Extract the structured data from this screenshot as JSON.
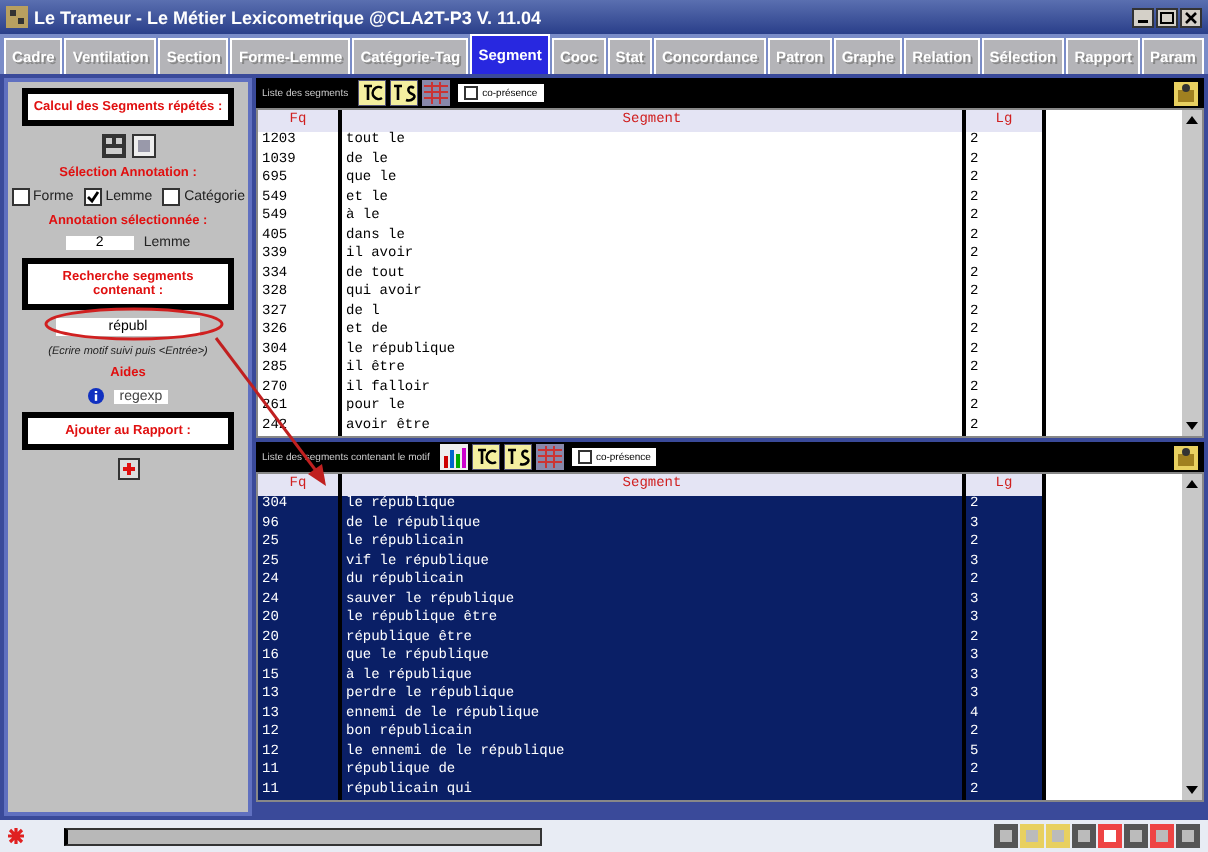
{
  "window": {
    "title": "Le Trameur - Le Métier Lexicometrique @CLA2T-P3 V. 11.04"
  },
  "tabs": [
    {
      "label": "Cadre",
      "selected": false
    },
    {
      "label": "Ventilation",
      "selected": false
    },
    {
      "label": "Section",
      "selected": false
    },
    {
      "label": "Forme-Lemme",
      "selected": false
    },
    {
      "label": "Catégorie-Tag",
      "selected": false
    },
    {
      "label": "Segment",
      "selected": true
    },
    {
      "label": "Cooc",
      "selected": false
    },
    {
      "label": "Stat",
      "selected": false
    },
    {
      "label": "Concordance",
      "selected": false
    },
    {
      "label": "Patron",
      "selected": false
    },
    {
      "label": "Graphe",
      "selected": false
    },
    {
      "label": "Relation",
      "selected": false
    },
    {
      "label": "Sélection",
      "selected": false
    },
    {
      "label": "Rapport",
      "selected": false
    },
    {
      "label": "Param",
      "selected": false
    }
  ],
  "left_panel": {
    "calc_heading": "Calcul des Segments répétés :",
    "annotation_heading": "Sélection Annotation :",
    "annotation_options": [
      {
        "label": "Forme",
        "checked": false
      },
      {
        "label": "Lemme",
        "checked": true
      },
      {
        "label": "Catégorie",
        "checked": false
      }
    ],
    "selected_heading": "Annotation sélectionnée :",
    "selected_value": "2",
    "selected_label": "Lemme",
    "search_heading": "Recherche segments contenant :",
    "search_value": "républ",
    "hint": "(Ecrire motif suivi puis <Entrée>)",
    "help_heading": "Aides",
    "regexp": "regexp",
    "report_heading": "Ajouter au Rapport :"
  },
  "grids": [
    {
      "toolbar_label": "Liste des segments",
      "copresence": {
        "label": "co-présence",
        "checked": false
      },
      "columns": [
        "Fq",
        "Segment",
        "Lg"
      ],
      "rows": [
        {
          "cells": [
            "1203",
            "tout le",
            "2"
          ],
          "selected": false
        },
        {
          "cells": [
            "1039",
            "de le",
            "2"
          ],
          "selected": false
        },
        {
          "cells": [
            "695",
            "que le",
            "2"
          ],
          "selected": false
        },
        {
          "cells": [
            "549",
            "et le",
            "2"
          ],
          "selected": false
        },
        {
          "cells": [
            "549",
            "à le",
            "2"
          ],
          "selected": false
        },
        {
          "cells": [
            "405",
            "dans le",
            "2"
          ],
          "selected": false
        },
        {
          "cells": [
            "339",
            "il avoir",
            "2"
          ],
          "selected": false
        },
        {
          "cells": [
            "334",
            "de tout",
            "2"
          ],
          "selected": false
        },
        {
          "cells": [
            "328",
            "qui avoir",
            "2"
          ],
          "selected": false
        },
        {
          "cells": [
            "327",
            "de l",
            "2"
          ],
          "selected": false
        },
        {
          "cells": [
            "326",
            "et de",
            "2"
          ],
          "selected": false
        },
        {
          "cells": [
            "304",
            "le république",
            "2"
          ],
          "selected": false
        },
        {
          "cells": [
            "285",
            "il être",
            "2"
          ],
          "selected": false
        },
        {
          "cells": [
            "270",
            "il falloir",
            "2"
          ],
          "selected": false
        },
        {
          "cells": [
            "261",
            "pour le",
            "2"
          ],
          "selected": false
        },
        {
          "cells": [
            "242",
            "avoir être",
            "2"
          ],
          "selected": false
        }
      ]
    },
    {
      "toolbar_label": "Liste des segments contenant le motif",
      "copresence": {
        "label": "co-présence",
        "checked": false
      },
      "columns": [
        "Fq",
        "Segment",
        "Lg"
      ],
      "rows": [
        {
          "cells": [
            "304",
            "le république",
            "2"
          ],
          "selected": true
        },
        {
          "cells": [
            "96",
            "de le république",
            "3"
          ],
          "selected": true
        },
        {
          "cells": [
            "25",
            "le républicain",
            "2"
          ],
          "selected": true
        },
        {
          "cells": [
            "25",
            "vif le république",
            "3"
          ],
          "selected": true
        },
        {
          "cells": [
            "24",
            "du républicain",
            "2"
          ],
          "selected": true
        },
        {
          "cells": [
            "24",
            "sauver le république",
            "3"
          ],
          "selected": true
        },
        {
          "cells": [
            "20",
            "le république être",
            "3"
          ],
          "selected": true
        },
        {
          "cells": [
            "20",
            "république être",
            "2"
          ],
          "selected": true
        },
        {
          "cells": [
            "16",
            "que le république",
            "3"
          ],
          "selected": true
        },
        {
          "cells": [
            "15",
            "à le république",
            "3"
          ],
          "selected": true
        },
        {
          "cells": [
            "13",
            "perdre le république",
            "3"
          ],
          "selected": true
        },
        {
          "cells": [
            "13",
            "ennemi de le république",
            "4"
          ],
          "selected": true
        },
        {
          "cells": [
            "12",
            "bon républicain",
            "2"
          ],
          "selected": true
        },
        {
          "cells": [
            "12",
            "le ennemi de le république",
            "5"
          ],
          "selected": true
        },
        {
          "cells": [
            "11",
            "république de",
            "2"
          ],
          "selected": true
        },
        {
          "cells": [
            "11",
            "républicain qui",
            "2"
          ],
          "selected": true
        }
      ]
    }
  ],
  "status_bar": {
    "level": 1
  }
}
